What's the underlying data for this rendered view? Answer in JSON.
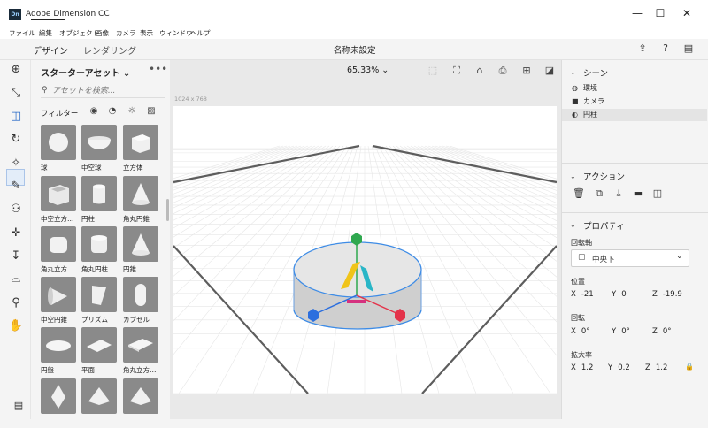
{
  "window": {
    "app_icon": "Dn",
    "title": "Adobe Dimension CC",
    "minimize": "—",
    "maximize": "☐",
    "close": "✕"
  },
  "menu": [
    "ファイル",
    "編集",
    "オブジェクト",
    "画像",
    "カメラ",
    "表示",
    "ウィンドウ",
    "ヘルプ"
  ],
  "modes": {
    "design": "デザイン",
    "render": "レンダリング"
  },
  "document_title": "名称未設定",
  "header_icons": [
    "share-icon",
    "help-icon",
    "feedback-icon"
  ],
  "toolbar": [
    "add-icon",
    "select-icon",
    "move-icon",
    "rotate-icon",
    "scale-icon",
    "magic-wand-icon",
    "eyedropper-icon",
    "sample-icon",
    "axis-icon",
    "move-vertical-icon",
    "orbit-icon",
    "zoom-icon",
    "hand-icon"
  ],
  "assets": {
    "title": "スターターアセット",
    "chevron": "⌄",
    "more": "•••",
    "search_placeholder": "アセットを検索...",
    "filter_label": "フィルター",
    "filter_icons": [
      "models-filter-icon",
      "materials-filter-icon",
      "lights-filter-icon",
      "images-filter-icon"
    ],
    "items": [
      {
        "label": "球",
        "shape": "sphere"
      },
      {
        "label": "中空球",
        "shape": "bowl"
      },
      {
        "label": "立方体",
        "shape": "cube"
      },
      {
        "label": "中空立方…",
        "shape": "open-cube"
      },
      {
        "label": "円柱",
        "shape": "cylinder"
      },
      {
        "label": "角丸円錐",
        "shape": "cone"
      },
      {
        "label": "角丸立方…",
        "shape": "rounded-cube"
      },
      {
        "label": "角丸円柱",
        "shape": "rounded-cylinder"
      },
      {
        "label": "円錐",
        "shape": "cone"
      },
      {
        "label": "中空円錐",
        "shape": "hollow-cone"
      },
      {
        "label": "プリズム",
        "shape": "prism"
      },
      {
        "label": "カプセル",
        "shape": "capsule"
      },
      {
        "label": "円盤",
        "shape": "disc"
      },
      {
        "label": "平面",
        "shape": "plane"
      },
      {
        "label": "角丸立方…",
        "shape": "rounded-slab"
      },
      {
        "label": "",
        "shape": "diamond"
      },
      {
        "label": "",
        "shape": "pyramid"
      },
      {
        "label": "",
        "shape": "pyramid"
      }
    ]
  },
  "viewport": {
    "zoom": "65.33%",
    "zoom_chevron": "⌄",
    "canvas_size": "1024 x 768",
    "icons": [
      "frame-icon",
      "camera-fit-icon",
      "camera-home-icon",
      "camera-bookmark-icon",
      "camera-add-icon",
      "render-preview-icon"
    ]
  },
  "scene": {
    "title": "シーン",
    "items": [
      {
        "label": "環境",
        "icon": "globe-icon",
        "glyph": "◍"
      },
      {
        "label": "カメラ",
        "icon": "camera-icon",
        "glyph": "■"
      },
      {
        "label": "円柱",
        "icon": "cylinder-icon",
        "glyph": "◐"
      }
    ]
  },
  "actions": {
    "title": "アクション",
    "icons": [
      "delete-icon",
      "duplicate-icon",
      "drop-to-ground-icon",
      "group-icon",
      "export-icon"
    ]
  },
  "properties": {
    "title": "プロパティ",
    "pivot_label": "回転軸",
    "pivot_value": "中央下",
    "pivot_chevron": "⌄",
    "position_label": "位置",
    "position": {
      "x": "-21",
      "y": "0",
      "z": "-19.9"
    },
    "rotation_label": "回転",
    "rotation": {
      "x": "0°",
      "y": "0°",
      "z": "0°"
    },
    "scale_label": "拡大率",
    "scale": {
      "x": "1.2",
      "y": "0.2",
      "z": "1.2"
    }
  },
  "colors": {
    "accent": "#2680eb",
    "gizmo_x": "#e4334a",
    "gizmo_y": "#2fa84f",
    "gizmo_z": "#2c6fde"
  }
}
